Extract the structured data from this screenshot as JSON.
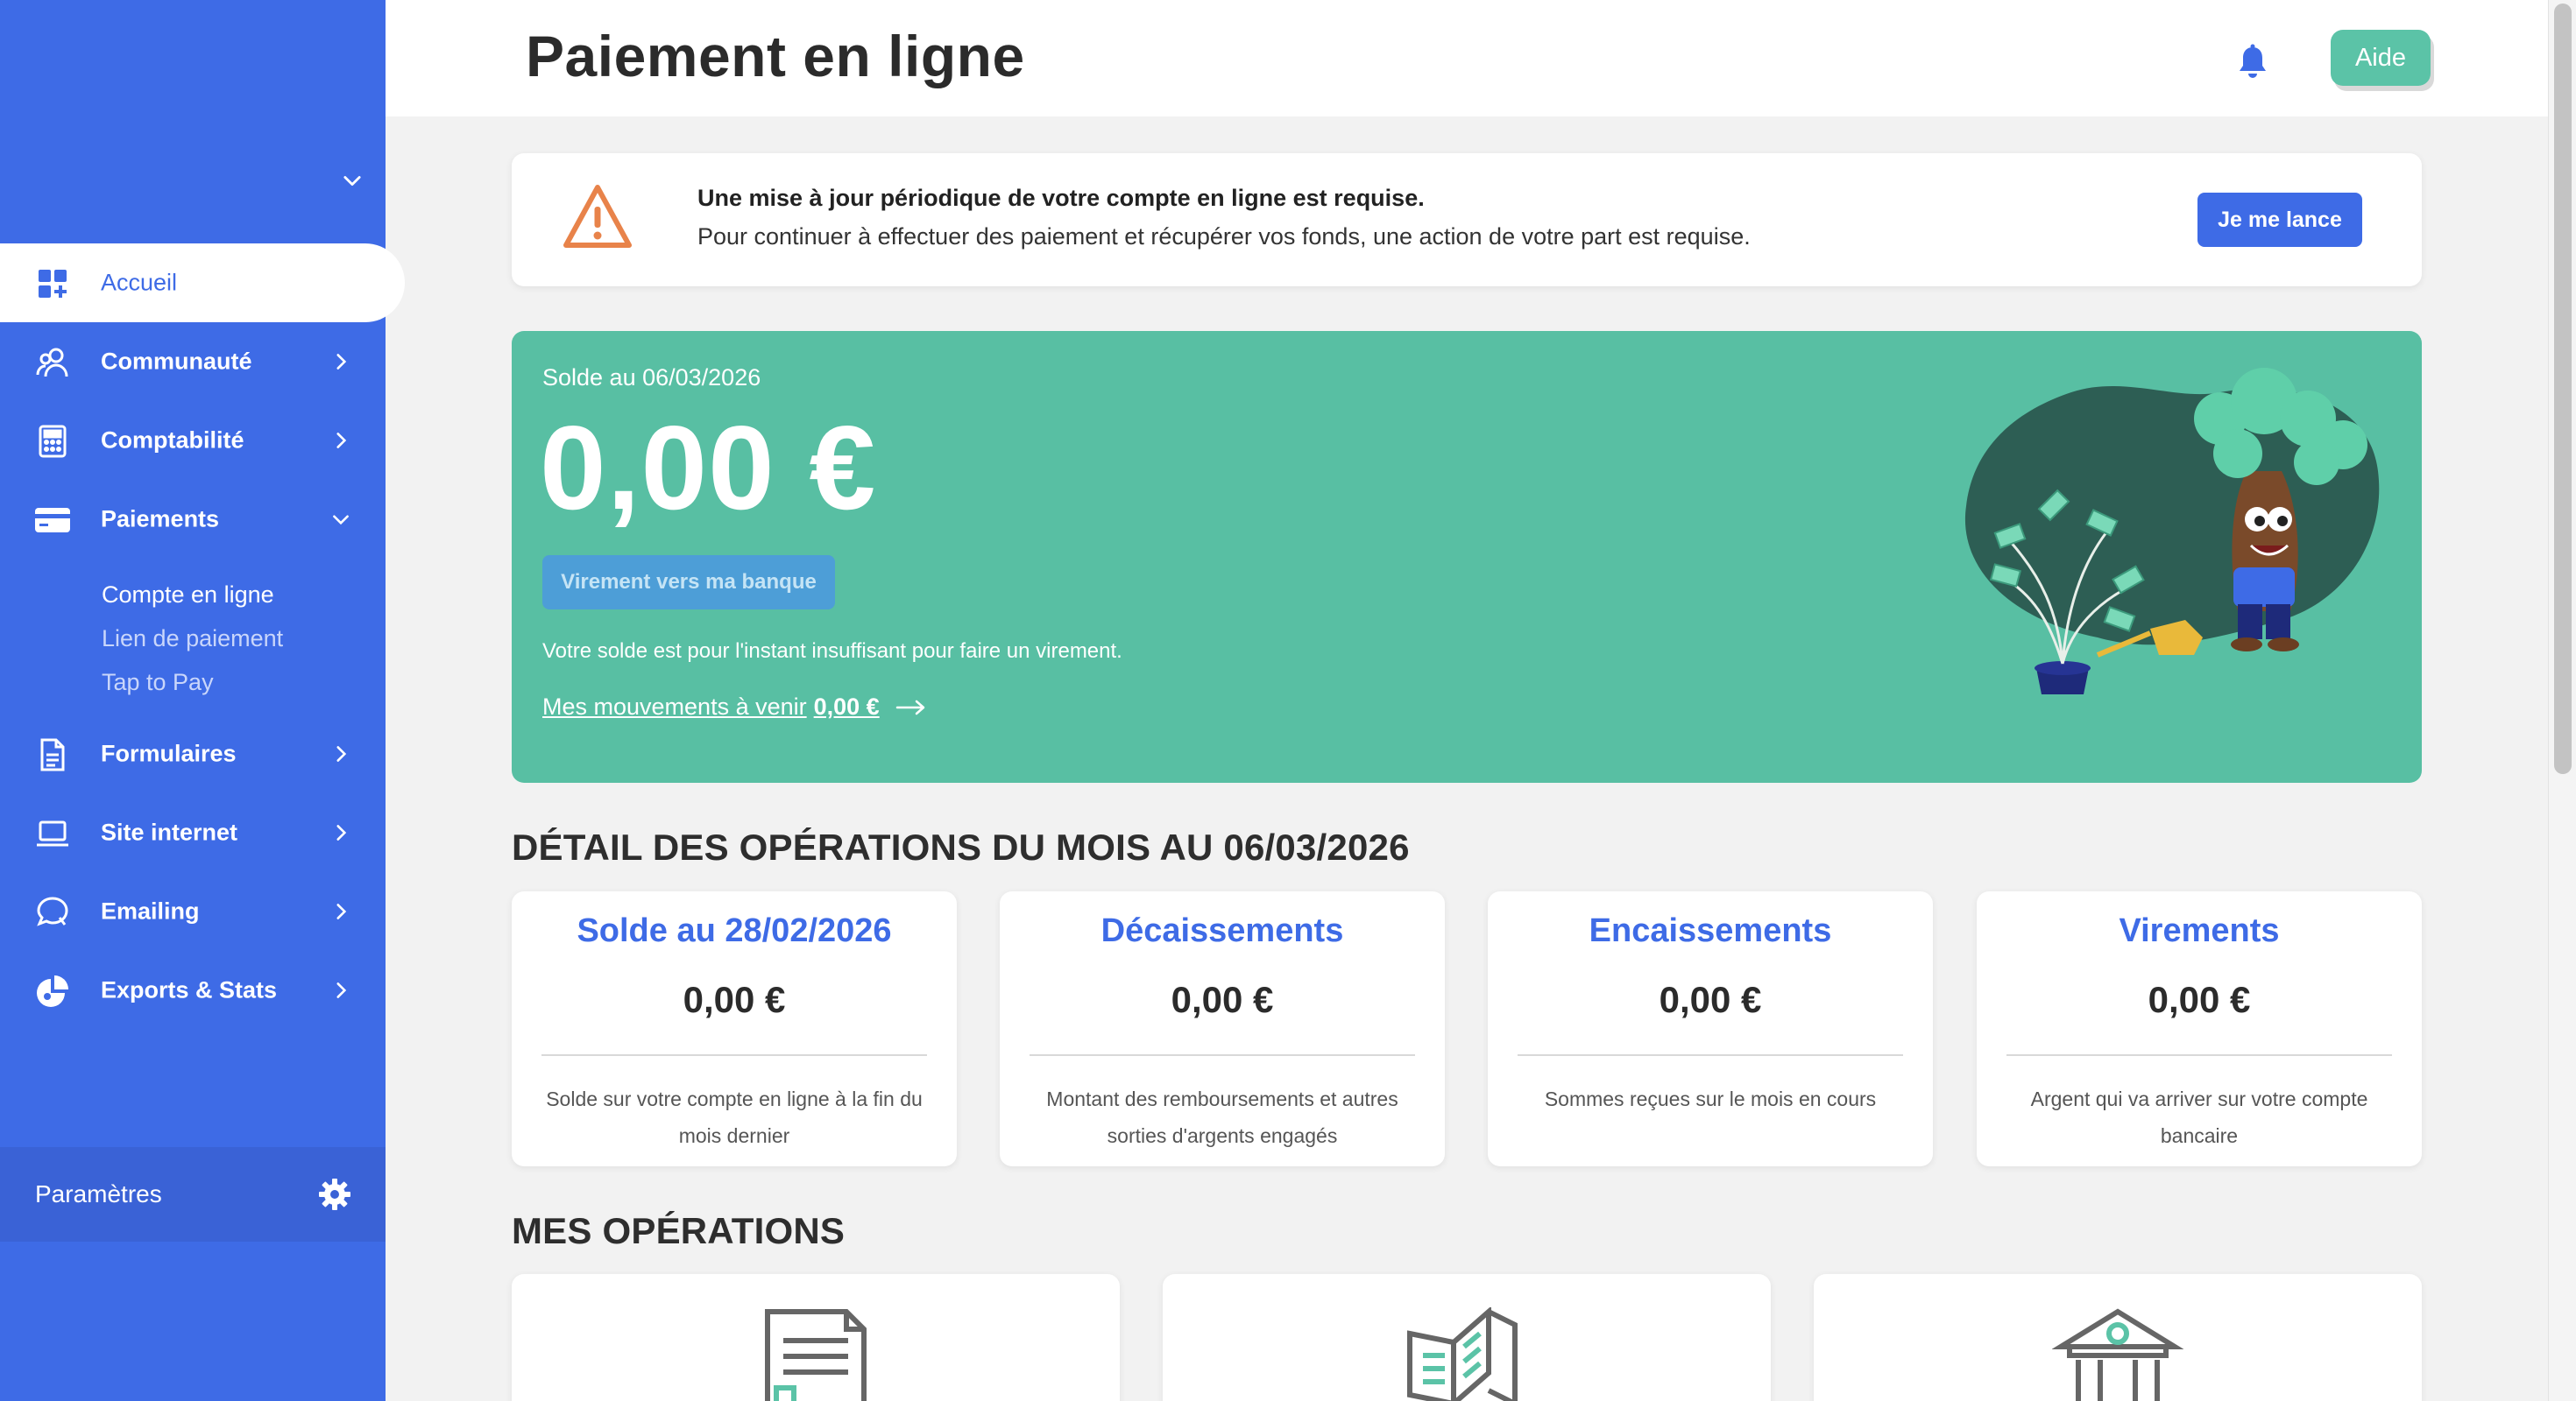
{
  "header": {
    "title": "Paiement en ligne",
    "help_label": "Aide"
  },
  "sidebar": {
    "items": [
      {
        "label": "Accueil",
        "icon": "dashboard-icon"
      },
      {
        "label": "Communauté",
        "icon": "users-icon"
      },
      {
        "label": "Comptabilité",
        "icon": "calculator-icon"
      },
      {
        "label": "Paiements",
        "icon": "credit-card-icon"
      },
      {
        "label": "Formulaires",
        "icon": "document-icon"
      },
      {
        "label": "Site internet",
        "icon": "laptop-icon"
      },
      {
        "label": "Emailing",
        "icon": "chat-icon"
      },
      {
        "label": "Exports & Stats",
        "icon": "pie-chart-icon"
      }
    ],
    "payments_sub": [
      "Compte en ligne",
      "Lien de paiement",
      "Tap to Pay"
    ],
    "settings_label": "Paramètres"
  },
  "alert": {
    "title": "Une mise à jour périodique de votre compte en ligne est requise.",
    "text": "Pour continuer à effectuer des paiement et récupérer vos fonds, une action de votre part est requise.",
    "button": "Je me lance",
    "icon": "warning-icon"
  },
  "balance": {
    "date_label": "Solde au 06/03/2026",
    "amount": "0,00 €",
    "transfer_button": "Virement vers ma banque",
    "note": "Votre solde est pour l'instant insuffisant pour faire un virement.",
    "upcoming_label": "Mes mouvements à venir",
    "upcoming_amount": "0,00 €"
  },
  "details": {
    "title": "DÉTAIL DES OPÉRATIONS DU MOIS AU 06/03/2026",
    "cards": [
      {
        "title": "Solde au 28/02/2026",
        "value": "0,00 €",
        "desc": "Solde sur votre compte en ligne à la fin du mois dernier"
      },
      {
        "title": "Décaissements",
        "value": "0,00 €",
        "desc": "Montant des remboursements et autres sorties d'argents engagés"
      },
      {
        "title": "Encaissements",
        "value": "0,00 €",
        "desc": "Sommes reçues sur le mois en cours"
      },
      {
        "title": "Virements",
        "value": "0,00 €",
        "desc": "Argent qui va arriver sur votre compte bancaire"
      }
    ]
  },
  "operations": {
    "title": "MES OPÉRATIONS",
    "cards": [
      {
        "icon": "invoice-icon"
      },
      {
        "icon": "ledger-book-icon"
      },
      {
        "icon": "bank-icon"
      }
    ]
  },
  "colors": {
    "primary": "#3e6be6",
    "accent_green": "#58bfa3",
    "warning": "#e8834a"
  }
}
